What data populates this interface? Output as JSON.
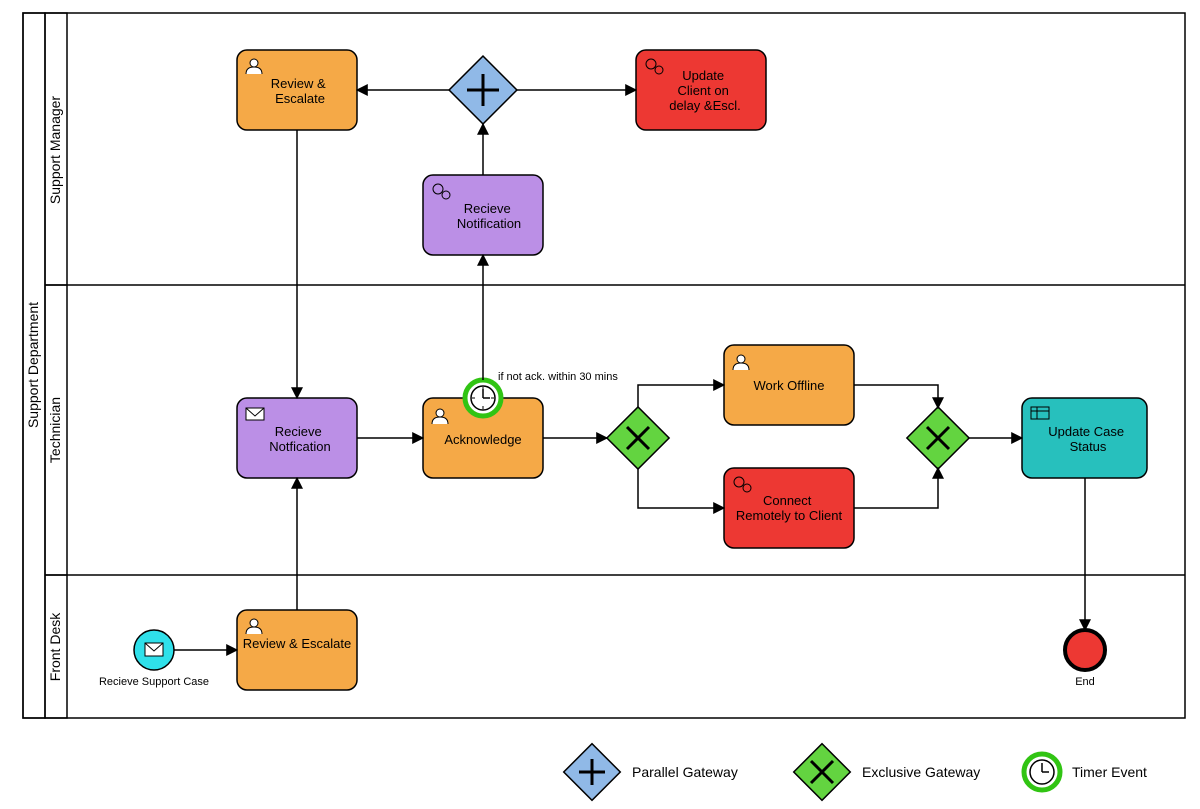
{
  "pool": {
    "title": "Support Department"
  },
  "lanes": {
    "manager": "Support Manager",
    "technician": "Technician",
    "frontdesk": "Front Desk"
  },
  "tasks": {
    "review_escalate_mgr": "Review & Escalate",
    "update_client": "Update Client on delay &Escl.",
    "receive_notification_mgr": "Recieve Notification",
    "receive_notification_tech": "Recieve Notfication",
    "acknowledge": "Acknowledge",
    "work_offline": "Work Offline",
    "connect_remote": "Connect Remotely to Client",
    "update_case": "Update Case Status",
    "review_escalate_fd": "Review & Escalate"
  },
  "events": {
    "start_label": "Recieve Support Case",
    "end_label": "End",
    "timer_label": "if not ack. within 30 mins"
  },
  "legend": {
    "parallel": "Parallel Gateway",
    "exclusive": "Exclusive Gateway",
    "timer": "Timer Event"
  },
  "colors": {
    "orange": "#F5A947",
    "red": "#ED3833",
    "purple": "#BB8FE6",
    "teal": "#27C0BD",
    "green": "#63D440",
    "blue": "#90B9E7",
    "cyan": "#2FE0EA",
    "stroke": "#000000"
  }
}
